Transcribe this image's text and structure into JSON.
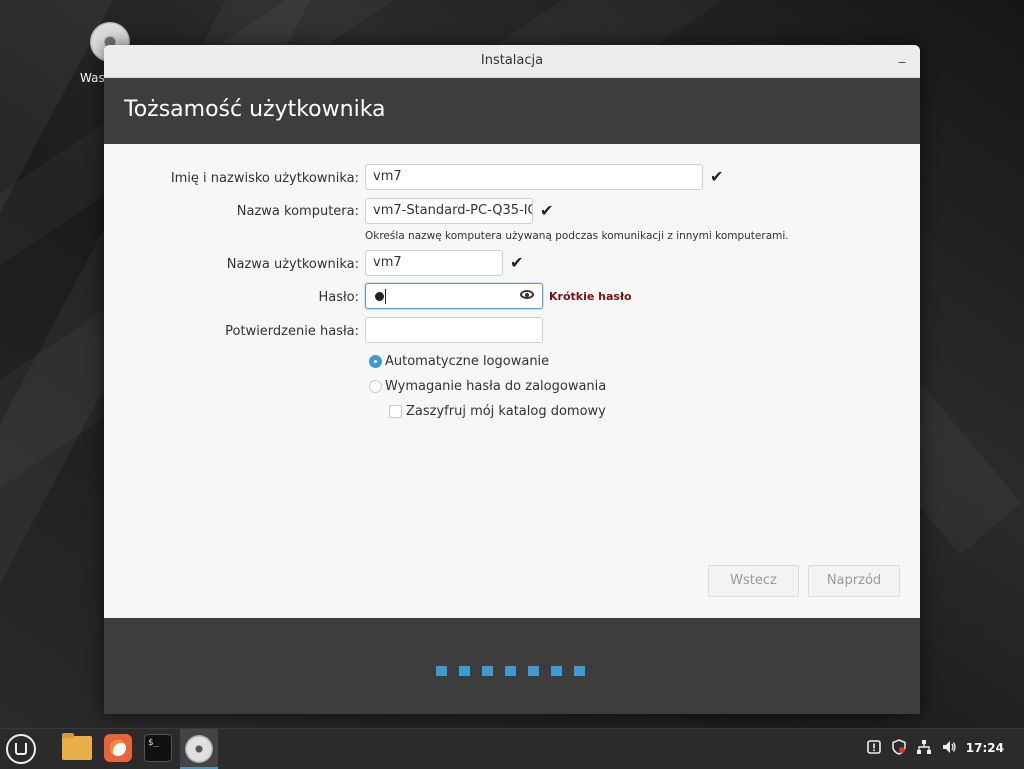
{
  "desktop": {
    "icon_label": "Was"
  },
  "window": {
    "title": "Instalacja",
    "minimize_glyph": "_",
    "header_title": "Tożsamość użytkownika"
  },
  "form": {
    "full_name": {
      "label": "Imię i nazwisko użytkownika:",
      "value": "vm7",
      "valid": "✔"
    },
    "computer_name": {
      "label": "Nazwa komputera:",
      "value": "vm7-Standard-PC-Q35-IC",
      "valid": "✔",
      "hint": "Określa nazwę komputera używaną podczas komunikacji z innymi komputerami."
    },
    "username": {
      "label": "Nazwa użytkownika:",
      "value": "vm7",
      "valid": "✔"
    },
    "password": {
      "label": "Hasło:",
      "warning": "Krótkie hasło"
    },
    "confirm_password": {
      "label": "Potwierdzenie hasła:",
      "value": ""
    },
    "options": {
      "auto_login": {
        "label": "Automatyczne logowanie",
        "selected": true
      },
      "require_password": {
        "label": "Wymaganie hasła do zalogowania",
        "selected": false
      },
      "encrypt_home": {
        "label": "Zaszyfruj mój katalog domowy",
        "checked": false
      }
    }
  },
  "buttons": {
    "back": "Wstecz",
    "next": "Naprzód"
  },
  "progress": {
    "steps": 7
  },
  "taskbar": {
    "terminal_glyph": "$_",
    "clock": "17:24",
    "tray": [
      "update-icon",
      "shield-icon",
      "network-icon",
      "volume-icon"
    ]
  },
  "colors": {
    "accent": "#3a9bd5",
    "warning": "#7a1010",
    "header": "#3d3d3d"
  }
}
